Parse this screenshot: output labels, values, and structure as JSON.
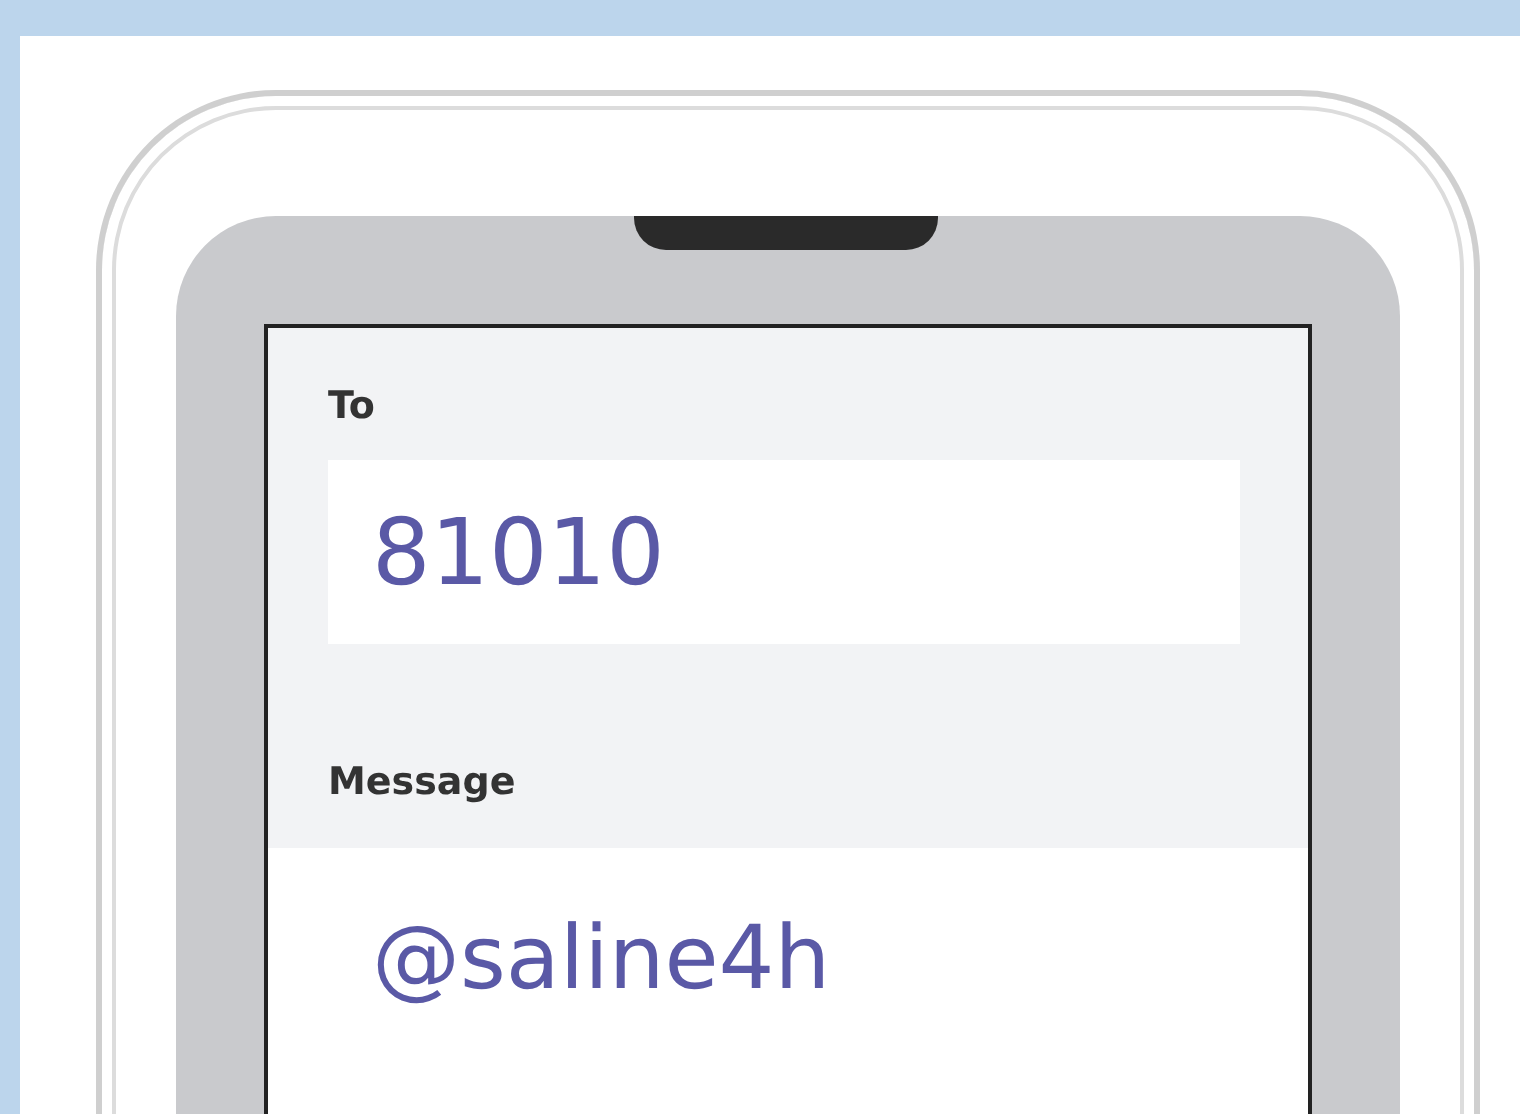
{
  "screen": {
    "to": {
      "label": "To",
      "value": "81010"
    },
    "message": {
      "label": "Message",
      "value": "@saline4h"
    }
  }
}
